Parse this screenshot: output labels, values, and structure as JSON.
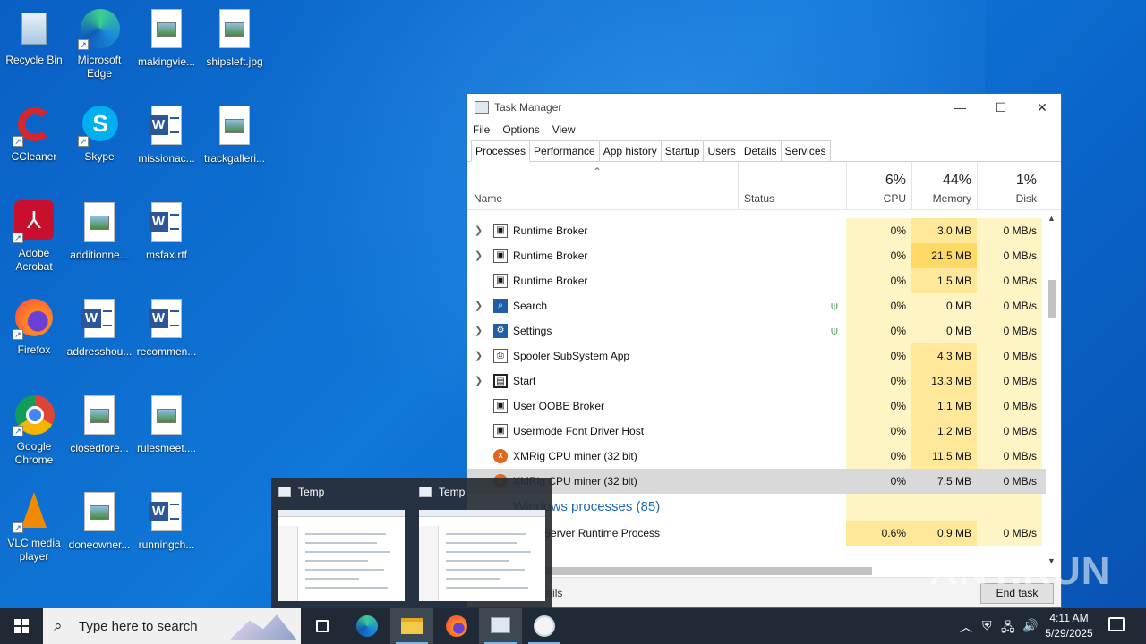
{
  "desktop": {
    "icons": [
      {
        "label": "Recycle Bin",
        "icon": "recycle-bin-icon"
      },
      {
        "label": "Microsoft Edge",
        "icon": "edge-icon"
      },
      {
        "label": "makingvie...",
        "icon": "image-file-icon"
      },
      {
        "label": "shipsleft.jpg",
        "icon": "image-file-icon"
      },
      {
        "label": "CCleaner",
        "icon": "ccleaner-icon"
      },
      {
        "label": "Skype",
        "icon": "skype-icon"
      },
      {
        "label": "missionac...",
        "icon": "word-file-icon"
      },
      {
        "label": "trackgalleri...",
        "icon": "image-file-icon"
      },
      {
        "label": "Adobe Acrobat",
        "icon": "acrobat-icon"
      },
      {
        "label": "additionne...",
        "icon": "image-file-icon"
      },
      {
        "label": "msfax.rtf",
        "icon": "word-file-icon"
      },
      {
        "label": "Firefox",
        "icon": "firefox-icon"
      },
      {
        "label": "addresshou...",
        "icon": "word-file-icon"
      },
      {
        "label": "recommen...",
        "icon": "word-file-icon"
      },
      {
        "label": "Google Chrome",
        "icon": "chrome-icon"
      },
      {
        "label": "closedfore...",
        "icon": "image-file-icon"
      },
      {
        "label": "rulesmeet....",
        "icon": "image-file-icon"
      },
      {
        "label": "VLC media player",
        "icon": "vlc-icon"
      },
      {
        "label": "doneowner...",
        "icon": "image-file-icon"
      },
      {
        "label": "runningch...",
        "icon": "word-file-icon"
      }
    ]
  },
  "taskmanager": {
    "title": "Task Manager",
    "menu": [
      "File",
      "Options",
      "View"
    ],
    "tabs": [
      "Processes",
      "Performance",
      "App history",
      "Startup",
      "Users",
      "Details",
      "Services"
    ],
    "columns": {
      "name": "Name",
      "status": "Status",
      "cpu_pct": "6%",
      "cpu": "CPU",
      "mem_pct": "44%",
      "mem": "Memory",
      "disk_pct": "1%",
      "disk": "Disk"
    },
    "rows": [
      {
        "name": "Runtime Broker",
        "cpu": "0%",
        "mem": "3.0 MB",
        "disk": "0 MB/s"
      },
      {
        "name": "Runtime Broker",
        "cpu": "0%",
        "mem": "21.5 MB",
        "disk": "0 MB/s"
      },
      {
        "name": "Runtime Broker",
        "cpu": "0%",
        "mem": "1.5 MB",
        "disk": "0 MB/s"
      },
      {
        "name": "Search",
        "cpu": "0%",
        "mem": "0 MB",
        "disk": "0 MB/s"
      },
      {
        "name": "Settings",
        "cpu": "0%",
        "mem": "0 MB",
        "disk": "0 MB/s"
      },
      {
        "name": "Spooler SubSystem App",
        "cpu": "0%",
        "mem": "4.3 MB",
        "disk": "0 MB/s"
      },
      {
        "name": "Start",
        "cpu": "0%",
        "mem": "13.3 MB",
        "disk": "0 MB/s"
      },
      {
        "name": "User OOBE Broker",
        "cpu": "0%",
        "mem": "1.1 MB",
        "disk": "0 MB/s"
      },
      {
        "name": "Usermode Font Driver Host",
        "cpu": "0%",
        "mem": "1.2 MB",
        "disk": "0 MB/s"
      },
      {
        "name": "XMRig CPU miner (32 bit)",
        "cpu": "0%",
        "mem": "11.5 MB",
        "disk": "0 MB/s"
      },
      {
        "name": "XMRig CPU miner (32 bit)",
        "cpu": "0%",
        "mem": "7.5 MB",
        "disk": "0 MB/s"
      }
    ],
    "group_header": "Windows processes (85)",
    "group_rows": [
      {
        "name": "Client Server Runtime Process",
        "cpu": "0.6%",
        "mem": "0.9 MB",
        "disk": "0 MB/s"
      }
    ],
    "footer": {
      "fewer": "Fewer details",
      "end_task": "End task"
    }
  },
  "thumbnails": [
    {
      "title": "Temp"
    },
    {
      "title": "Temp"
    }
  ],
  "watermark": "ANY.RUN",
  "taskbar": {
    "search_placeholder": "Type here to search",
    "time": "4:11 AM",
    "date": "5/29/2025"
  }
}
